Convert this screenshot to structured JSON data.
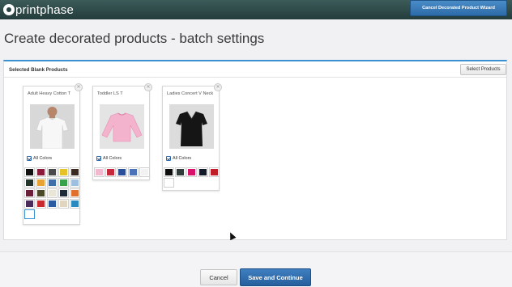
{
  "app": {
    "logo_text": "printphase",
    "cancel_wizard_label": "Cancel Decorated Product Wizard"
  },
  "page": {
    "title": "Create decorated products - batch settings"
  },
  "panel": {
    "title": "Selected Blank Products",
    "select_products_label": "Select Products"
  },
  "products": [
    {
      "name": "Adult Heavy Cotton T",
      "image": "white-tshirt",
      "all_colors_label": "All Colors",
      "all_colors_checked": true,
      "swatches": [
        "#111111",
        "#8b1a3a",
        "#4a4a4a",
        "#e6c229",
        "#3b2a22",
        "#22332a",
        "#e8a133",
        "#3f6ea8",
        "#38a14c",
        "#9fbfe0",
        "#6a1f3a",
        "#4a4a2a",
        "#e9e6d8",
        "#1d2a3a",
        "#e07030",
        "#4a2a5a",
        "#c82a30",
        "#2a5aa0",
        "#e0d6c0",
        "#2a8ac0",
        "#ffffff"
      ],
      "selected_swatch": 20
    },
    {
      "name": "Toddler LS T",
      "image": "pink-longsleeve",
      "all_colors_label": "All Colors",
      "all_colors_checked": true,
      "swatches": [
        "#f2b8d0",
        "#c8283c",
        "#2a4f9a",
        "#4a73b8",
        "#f2f2f2"
      ],
      "selected_swatch": null
    },
    {
      "name": "Ladies Concert V Neck",
      "image": "black-vneck",
      "all_colors_label": "All Colors",
      "all_colors_checked": true,
      "swatches": [
        "#0d0d0d",
        "#2f3a3a",
        "#d8126a",
        "#141a2a",
        "#c21e2a",
        "#ffffff"
      ],
      "selected_swatch": null
    }
  ],
  "footer": {
    "cancel_label": "Cancel",
    "save_label": "Save and Continue"
  },
  "colors": {
    "topbar": "#2e4a49",
    "primary": "#2d6ba9",
    "panel_accent": "#3a90d0"
  }
}
